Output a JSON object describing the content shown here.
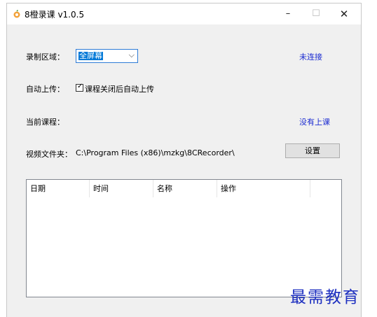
{
  "window": {
    "title": "8橙录课 v1.0.5",
    "controls": {
      "minimize": "–",
      "maximize": "☐",
      "close": "✕"
    }
  },
  "form": {
    "record_area_label": "录制区域：",
    "record_area_value": "全屏幕",
    "auto_upload_label": "自动上传：",
    "auto_upload_checkbox_label": "课程关闭后自动上传",
    "auto_upload_checked": true,
    "current_course_label": "当前课程：",
    "video_folder_label": "视频文件夹：",
    "video_folder_path": "C:\\Program Files (x86)\\mzkg\\8CRecorder\\",
    "settings_button": "设置"
  },
  "status": {
    "connection": "未连接",
    "course": "没有上课"
  },
  "table": {
    "columns": [
      "日期",
      "时间",
      "名称",
      "操作"
    ],
    "rows": []
  },
  "watermark": "最需教育",
  "colors": {
    "link": "#1b2bd1",
    "selection": "#0078d7",
    "watermark": "#1d2fc0"
  }
}
